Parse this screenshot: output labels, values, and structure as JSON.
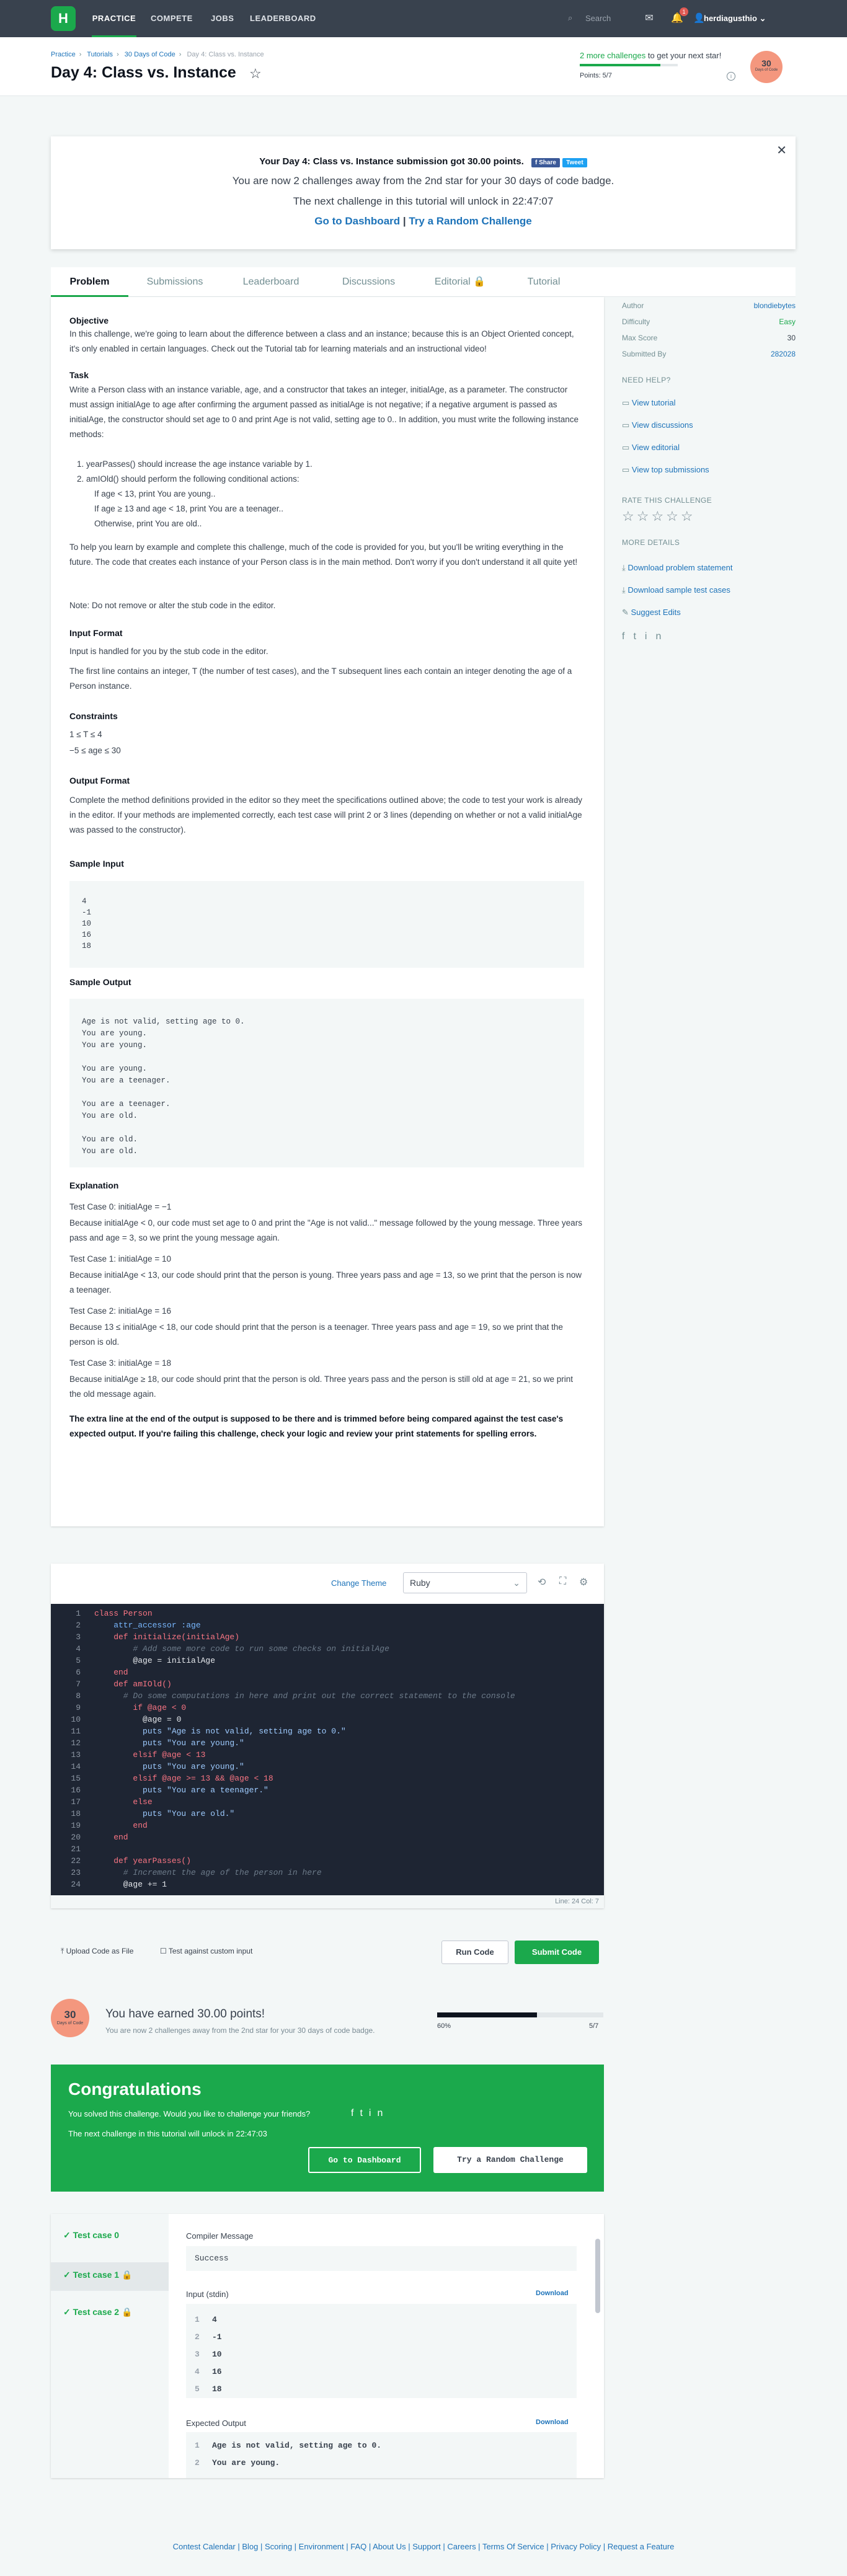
{
  "nav": {
    "logo": "H",
    "links": [
      "PRACTICE",
      "COMPETE",
      "JOBS",
      "LEADERBOARD"
    ],
    "search_placeholder": "Search",
    "notif_count": "1",
    "username": "herdiagusthio"
  },
  "breadcrumb": [
    "Practice",
    "Tutorials",
    "30 Days of Code",
    "Day 4: Class vs. Instance"
  ],
  "page_title": "Day 4: Class vs. Instance",
  "progress": {
    "next_star_link": "2 more challenges",
    "next_star_text": " to get your next star!",
    "points_label": "Points: 5/7",
    "fill_fraction": 0.82,
    "badge_num": "30",
    "badge_label": "Days of Code"
  },
  "banner": {
    "line1": "Your Day 4: Class vs. Instance submission got 30.00 points.",
    "share": "f Share",
    "tweet": "Tweet",
    "line2": "You are now 2 challenges away from the 2nd star for your 30 days of code badge.",
    "line3": "The next challenge in this tutorial will unlock in 22:47:07",
    "link1": "Go to Dashboard",
    "sep": " | ",
    "link2": "Try a Random Challenge"
  },
  "tabs": [
    "Problem",
    "Submissions",
    "Leaderboard",
    "Discussions",
    "Editorial 🔒",
    "Tutorial"
  ],
  "problem": {
    "objective_h": "Objective",
    "objective": "In this challenge, we're going to learn about the difference between a class and an instance; because this is an Object Oriented concept, it's only enabled in certain languages. Check out the Tutorial tab for learning materials and an instructional video!",
    "task_h": "Task",
    "task1": "Write a Person class with an instance variable, age, and a constructor that takes an integer, initialAge, as a parameter. The constructor must assign initialAge to age after confirming the argument passed as initialAge is not negative; if a negative argument is passed as initialAge, the constructor should set age to 0 and print Age is not valid, setting age to 0.. In addition, you must write the following instance methods:",
    "li1": "1. yearPasses() should increase the age instance variable by 1.",
    "li2": "2. amIOld() should perform the following conditional actions:",
    "sub1": "If age < 13, print You are young..",
    "sub2": "If age ≥ 13 and age < 18, print You are a teenager..",
    "sub3": "Otherwise, print You are old..",
    "task2": "To help you learn by example and complete this challenge, much of the code is provided for you, but you'll be writing everything in the future. The code that creates each instance of your Person class is in the main method. Don't worry if you don't understand it all quite yet!",
    "note": "Note: Do not remove or alter the stub code in the editor.",
    "input_h": "Input Format",
    "input1": "Input is handled for you by the stub code in the editor.",
    "input2": "The first line contains an integer, T (the number of test cases), and the T subsequent lines each contain an integer denoting the age of a Person instance.",
    "constraints_h": "Constraints",
    "c1": "1 ≤ T ≤ 4",
    "c2": "−5 ≤ age ≤ 30",
    "output_h": "Output Format",
    "output": "Complete the method definitions provided in the editor so they meet the specifications outlined above; the code to test your work is already in the editor. If your methods are implemented correctly, each test case will print 2 or 3 lines (depending on whether or not a valid initialAge was passed to the constructor).",
    "sample_in_h": "Sample Input",
    "sample_in": [
      "4",
      "-1",
      "10",
      "16",
      "18"
    ],
    "sample_out_h": "Sample Output",
    "sample_out": [
      "Age is not valid, setting age to 0.",
      "You are young.",
      "You are young.",
      "",
      "You are young.",
      "You are a teenager.",
      "",
      "You are a teenager.",
      "You are old.",
      "",
      "You are old.",
      "You are old."
    ],
    "expl_h": "Explanation",
    "e0h": "Test Case 0: initialAge = −1",
    "e0": "Because initialAge < 0, our code must set age to 0 and print the \"Age is not valid...\" message followed by the young message. Three years pass and age = 3, so we print the young message again.",
    "e1h": "Test Case 1: initialAge = 10",
    "e1": "Because initialAge < 13, our code should print that the person is young. Three years pass and age = 13, so we print that the person is now a teenager.",
    "e2h": "Test Case 2: initialAge = 16",
    "e2": "Because 13 ≤ initialAge < 18, our code should print that the person is a teenager. Three years pass and age = 19, so we print that the person is old.",
    "e3h": "Test Case 3: initialAge = 18",
    "e3": "Because initialAge ≥ 18, our code should print that the person is old. Three years pass and the person is still old at age = 21, so we print the old message again.",
    "final": "The extra line at the end of the output is supposed to be there and is trimmed before being compared against the test case's expected output. If you're failing this challenge, check your logic and review your print statements for spelling errors."
  },
  "sidebar": {
    "rows": [
      {
        "k": "Author",
        "v": "blondiebytes"
      },
      {
        "k": "Difficulty",
        "v": "Easy"
      },
      {
        "k": "Max Score",
        "v": "30"
      },
      {
        "k": "Submitted By",
        "v": "282028"
      }
    ],
    "need_help": "NEED HELP?",
    "help_links": [
      "View tutorial",
      "View discussions",
      "View editorial",
      "View top submissions"
    ],
    "rate": "RATE THIS CHALLENGE",
    "rating": "☆☆☆☆☆",
    "more": "MORE DETAILS",
    "more_links": [
      "Download problem statement",
      "Download sample test cases",
      "Suggest Edits"
    ]
  },
  "editor": {
    "change_theme": "Change Theme",
    "language": "Ruby",
    "lines": [
      "class Person",
      "    attr_accessor :age",
      "    def initialize(initialAge)",
      "        # Add some more code to run some checks on initialAge",
      "        @age = initialAge",
      "    end",
      "    def amIOld()",
      "      # Do some computations in here and print out the correct statement to the console",
      "        if @age < 0",
      "          @age = 0",
      "          puts \"Age is not valid, setting age to 0.\"",
      "          puts \"You are young.\"",
      "        elsif @age < 13",
      "          puts \"You are young.\"",
      "        elsif @age >= 13 && @age < 18",
      "          puts \"You are a teenager.\"",
      "        else",
      "          puts \"You are old.\"",
      "        end",
      "    end",
      "",
      "    def yearPasses()",
      "      # Increment the age of the person in here",
      "      @age += 1"
    ],
    "status": "Line: 24 Col: 7",
    "upload": "Upload Code as File",
    "custom_input": "Test against custom input",
    "run": "Run Code",
    "submit": "Submit Code"
  },
  "earned": {
    "badge_num": "30",
    "badge_label": "Days of Code",
    "title": "You have earned 30.00 points!",
    "sub": "You are now 2 challenges away from the 2nd star for your 30 days of code badge.",
    "pct": "60%",
    "frac": "5/7",
    "fill_fraction": 0.6
  },
  "congrats": {
    "title": "Congratulations",
    "line1": "You solved this challenge. Would you like to challenge your friends?",
    "line2": "The next challenge in this tutorial will unlock in 22:47:03",
    "btn1": "Go to Dashboard",
    "btn2": "Try a Random Challenge"
  },
  "tests": {
    "cases": [
      "Test case 0",
      "Test case 1 🔒",
      "Test case 2 🔒"
    ],
    "compiler_h": "Compiler Message",
    "compiler": "Success",
    "input_h": "Input (stdin)",
    "download": "Download",
    "input": [
      "4",
      "-1",
      "10",
      "16",
      "18"
    ],
    "expected_h": "Expected Output",
    "expected": [
      "Age is not valid, setting age to 0.",
      "You are young."
    ]
  },
  "footer": "Contest Calendar | Blog | Scoring | Environment | FAQ | About Us | Support | Careers | Terms Of Service | Privacy Policy | Request a Feature",
  "colors": {
    "brand": "#1ba94c",
    "nav": "#39424e",
    "link": "#1d73b9",
    "badge": "#f4977e"
  }
}
